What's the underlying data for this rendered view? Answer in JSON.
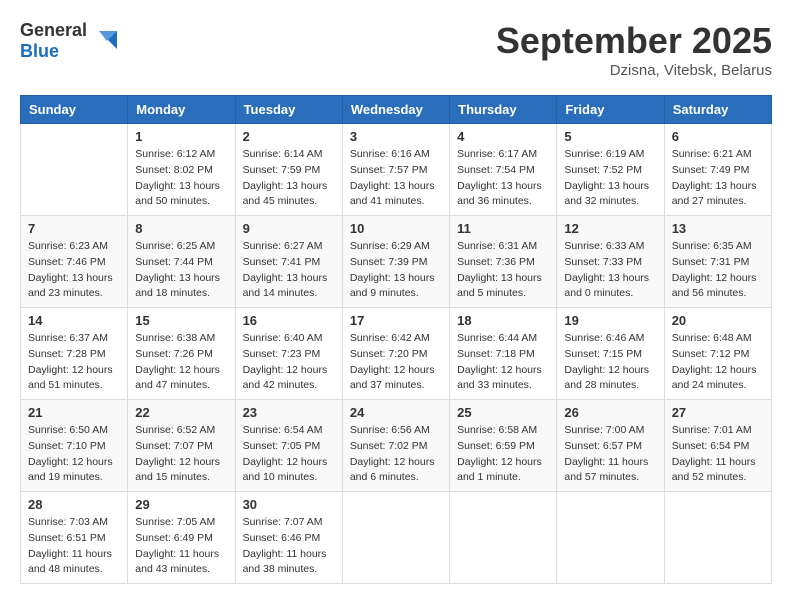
{
  "header": {
    "logo_general": "General",
    "logo_blue": "Blue",
    "month_title": "September 2025",
    "location": "Dzisna, Vitebsk, Belarus"
  },
  "calendar": {
    "days_of_week": [
      "Sunday",
      "Monday",
      "Tuesday",
      "Wednesday",
      "Thursday",
      "Friday",
      "Saturday"
    ],
    "weeks": [
      [
        {
          "day": "",
          "info": ""
        },
        {
          "day": "1",
          "info": "Sunrise: 6:12 AM\nSunset: 8:02 PM\nDaylight: 13 hours\nand 50 minutes."
        },
        {
          "day": "2",
          "info": "Sunrise: 6:14 AM\nSunset: 7:59 PM\nDaylight: 13 hours\nand 45 minutes."
        },
        {
          "day": "3",
          "info": "Sunrise: 6:16 AM\nSunset: 7:57 PM\nDaylight: 13 hours\nand 41 minutes."
        },
        {
          "day": "4",
          "info": "Sunrise: 6:17 AM\nSunset: 7:54 PM\nDaylight: 13 hours\nand 36 minutes."
        },
        {
          "day": "5",
          "info": "Sunrise: 6:19 AM\nSunset: 7:52 PM\nDaylight: 13 hours\nand 32 minutes."
        },
        {
          "day": "6",
          "info": "Sunrise: 6:21 AM\nSunset: 7:49 PM\nDaylight: 13 hours\nand 27 minutes."
        }
      ],
      [
        {
          "day": "7",
          "info": "Sunrise: 6:23 AM\nSunset: 7:46 PM\nDaylight: 13 hours\nand 23 minutes."
        },
        {
          "day": "8",
          "info": "Sunrise: 6:25 AM\nSunset: 7:44 PM\nDaylight: 13 hours\nand 18 minutes."
        },
        {
          "day": "9",
          "info": "Sunrise: 6:27 AM\nSunset: 7:41 PM\nDaylight: 13 hours\nand 14 minutes."
        },
        {
          "day": "10",
          "info": "Sunrise: 6:29 AM\nSunset: 7:39 PM\nDaylight: 13 hours\nand 9 minutes."
        },
        {
          "day": "11",
          "info": "Sunrise: 6:31 AM\nSunset: 7:36 PM\nDaylight: 13 hours\nand 5 minutes."
        },
        {
          "day": "12",
          "info": "Sunrise: 6:33 AM\nSunset: 7:33 PM\nDaylight: 13 hours\nand 0 minutes."
        },
        {
          "day": "13",
          "info": "Sunrise: 6:35 AM\nSunset: 7:31 PM\nDaylight: 12 hours\nand 56 minutes."
        }
      ],
      [
        {
          "day": "14",
          "info": "Sunrise: 6:37 AM\nSunset: 7:28 PM\nDaylight: 12 hours\nand 51 minutes."
        },
        {
          "day": "15",
          "info": "Sunrise: 6:38 AM\nSunset: 7:26 PM\nDaylight: 12 hours\nand 47 minutes."
        },
        {
          "day": "16",
          "info": "Sunrise: 6:40 AM\nSunset: 7:23 PM\nDaylight: 12 hours\nand 42 minutes."
        },
        {
          "day": "17",
          "info": "Sunrise: 6:42 AM\nSunset: 7:20 PM\nDaylight: 12 hours\nand 37 minutes."
        },
        {
          "day": "18",
          "info": "Sunrise: 6:44 AM\nSunset: 7:18 PM\nDaylight: 12 hours\nand 33 minutes."
        },
        {
          "day": "19",
          "info": "Sunrise: 6:46 AM\nSunset: 7:15 PM\nDaylight: 12 hours\nand 28 minutes."
        },
        {
          "day": "20",
          "info": "Sunrise: 6:48 AM\nSunset: 7:12 PM\nDaylight: 12 hours\nand 24 minutes."
        }
      ],
      [
        {
          "day": "21",
          "info": "Sunrise: 6:50 AM\nSunset: 7:10 PM\nDaylight: 12 hours\nand 19 minutes."
        },
        {
          "day": "22",
          "info": "Sunrise: 6:52 AM\nSunset: 7:07 PM\nDaylight: 12 hours\nand 15 minutes."
        },
        {
          "day": "23",
          "info": "Sunrise: 6:54 AM\nSunset: 7:05 PM\nDaylight: 12 hours\nand 10 minutes."
        },
        {
          "day": "24",
          "info": "Sunrise: 6:56 AM\nSunset: 7:02 PM\nDaylight: 12 hours\nand 6 minutes."
        },
        {
          "day": "25",
          "info": "Sunrise: 6:58 AM\nSunset: 6:59 PM\nDaylight: 12 hours\nand 1 minute."
        },
        {
          "day": "26",
          "info": "Sunrise: 7:00 AM\nSunset: 6:57 PM\nDaylight: 11 hours\nand 57 minutes."
        },
        {
          "day": "27",
          "info": "Sunrise: 7:01 AM\nSunset: 6:54 PM\nDaylight: 11 hours\nand 52 minutes."
        }
      ],
      [
        {
          "day": "28",
          "info": "Sunrise: 7:03 AM\nSunset: 6:51 PM\nDaylight: 11 hours\nand 48 minutes."
        },
        {
          "day": "29",
          "info": "Sunrise: 7:05 AM\nSunset: 6:49 PM\nDaylight: 11 hours\nand 43 minutes."
        },
        {
          "day": "30",
          "info": "Sunrise: 7:07 AM\nSunset: 6:46 PM\nDaylight: 11 hours\nand 38 minutes."
        },
        {
          "day": "",
          "info": ""
        },
        {
          "day": "",
          "info": ""
        },
        {
          "day": "",
          "info": ""
        },
        {
          "day": "",
          "info": ""
        }
      ]
    ]
  }
}
